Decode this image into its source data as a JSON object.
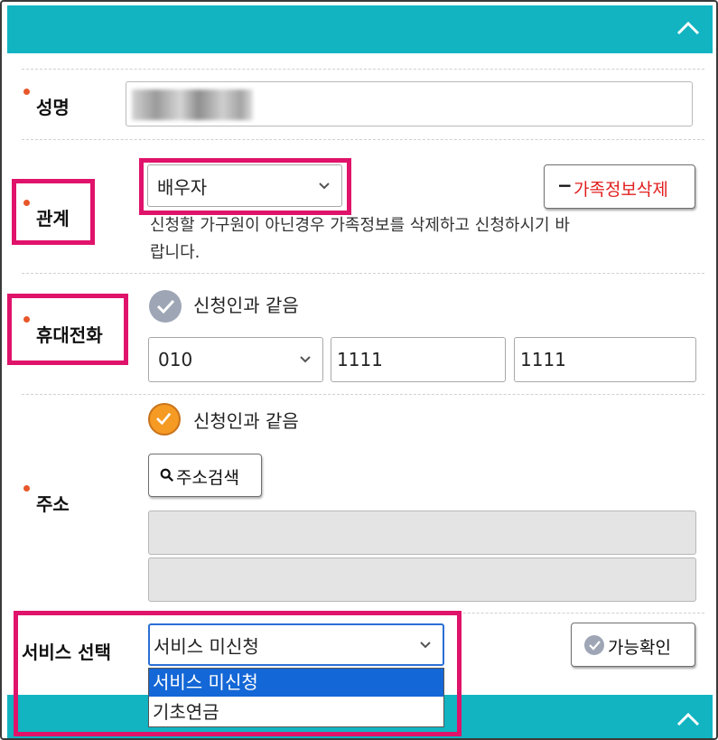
{
  "colors": {
    "accent": "#12b4c1",
    "highlight": "#e0136b",
    "required_dot": "#e8572a",
    "delete_text": "#e21e1e",
    "check_orange": "#f59a23",
    "check_gray": "#9ea6b6",
    "selected_option": "#1467d6"
  },
  "icons": {
    "collapse_top": "chevron-up-icon",
    "collapse_bottom": "chevron-up-icon",
    "check": "check-circle-icon",
    "search": "search-icon",
    "minus": "minus-icon"
  },
  "name_field": {
    "label": "성명",
    "value": ""
  },
  "relation": {
    "label": "관계",
    "selected": "배우자",
    "delete_button": {
      "symbol": "−",
      "label": "가족정보삭제"
    },
    "help_text_line1": "신청할 가구원이 아닌경우 가족정보를 삭제하고 신청하시기 바",
    "help_text_line2": "랍니다."
  },
  "mobile": {
    "label": "휴대전화",
    "same_as_applicant": "신청인과 같음",
    "same_checked": false,
    "prefix": "010",
    "middle": "1111",
    "last": "1111"
  },
  "address": {
    "label": "주소",
    "same_as_applicant": "신청인과 같음",
    "same_checked": true,
    "search_button": "주소검색",
    "line1": "",
    "line2": ""
  },
  "service": {
    "label": "서비스 선택",
    "selected": "서비스 미신청",
    "check_button": "가능확인",
    "options": [
      "서비스 미신청",
      "기초연금"
    ]
  }
}
